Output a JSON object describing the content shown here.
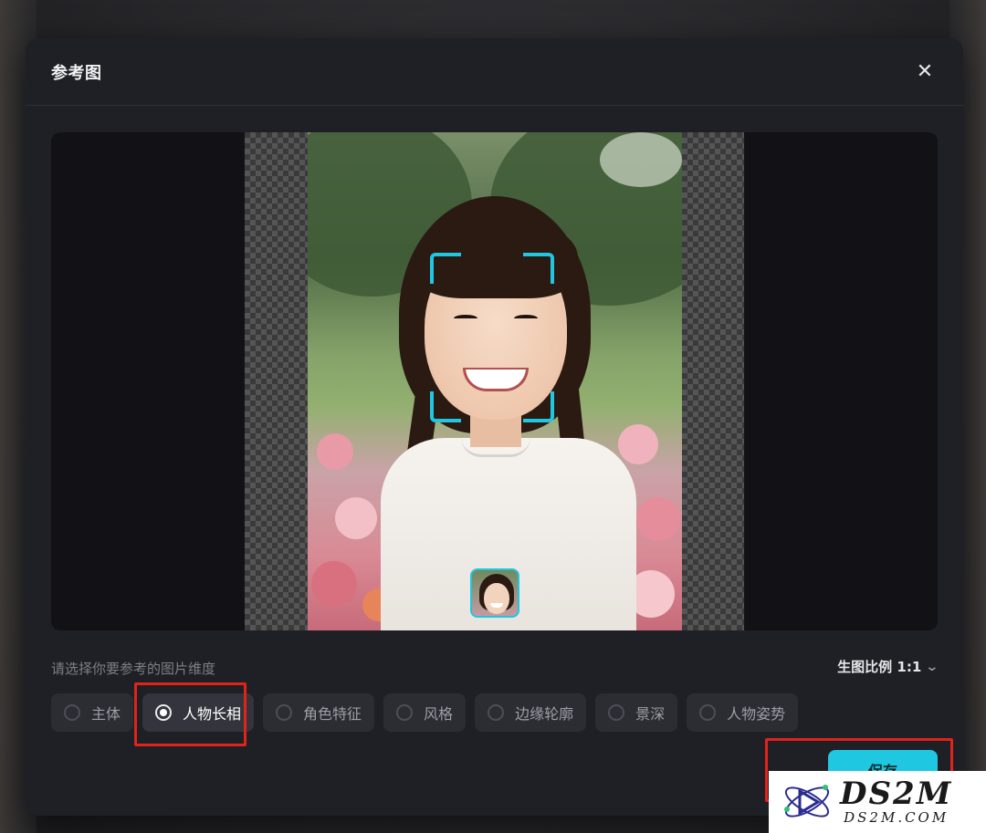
{
  "dialog": {
    "title": "参考图",
    "close_icon": "close-icon"
  },
  "preview": {
    "has_face_frame": true,
    "face_thumbnail": true
  },
  "selection": {
    "hint": "请选择你要参考的图片维度",
    "ratio_label": "生图比例 1:1",
    "options": [
      {
        "label": "主体",
        "selected": false
      },
      {
        "label": "人物长相",
        "selected": true
      },
      {
        "label": "角色特征",
        "selected": false
      },
      {
        "label": "风格",
        "selected": false
      },
      {
        "label": "边缘轮廓",
        "selected": false
      },
      {
        "label": "景深",
        "selected": false
      },
      {
        "label": "人物姿势",
        "selected": false
      }
    ]
  },
  "actions": {
    "save_label": "保存"
  },
  "colors": {
    "accent": "#1fc7e0",
    "dialog_bg": "#1f2025",
    "annotation": "#e2231a"
  },
  "watermark": {
    "logo_text": "DS2M",
    "domain_text": "DS2M.COM"
  }
}
